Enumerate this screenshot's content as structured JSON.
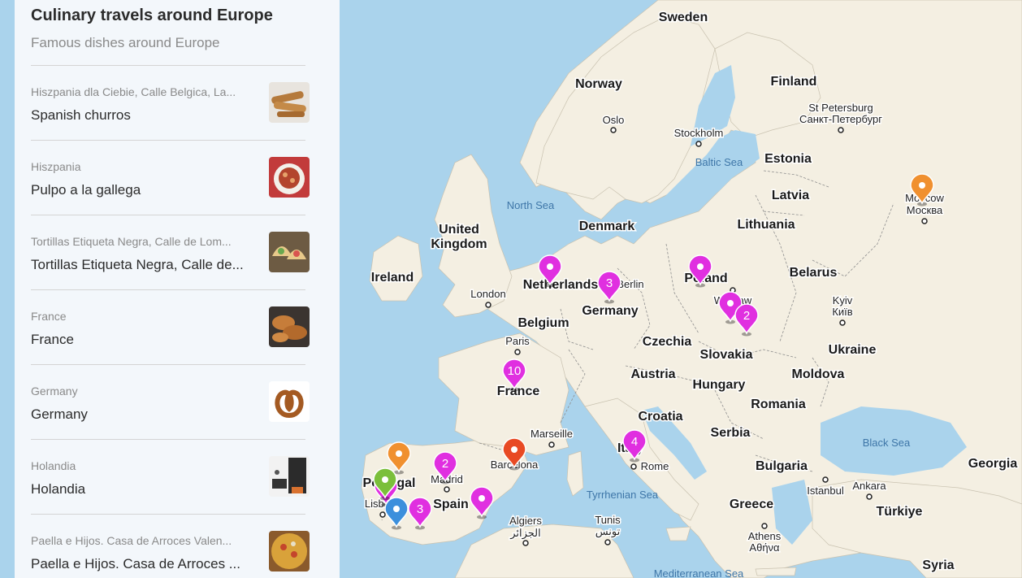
{
  "panel": {
    "title": "Culinary travels around Europe",
    "subtitle": "Famous dishes around Europe",
    "items": [
      {
        "subtitle": "Hiszpania dla Ciebie, Calle Belgica, La...",
        "title": "Spanish churros",
        "thumb": "churros-photo"
      },
      {
        "subtitle": "Hiszpania",
        "title": "Pulpo a la gallega",
        "thumb": "pulpo-photo"
      },
      {
        "subtitle": "Tortillas Etiqueta Negra, Calle de Lom...",
        "title": "Tortillas Etiqueta Negra, Calle de...",
        "thumb": "tacos-photo"
      },
      {
        "subtitle": "France",
        "title": "France",
        "thumb": "croissant-photo"
      },
      {
        "subtitle": "Germany",
        "title": "Germany",
        "thumb": "pretzel-photo"
      },
      {
        "subtitle": "Holandia",
        "title": "Holandia",
        "thumb": "waffle-photo"
      },
      {
        "subtitle": "Paella e Hijos. Casa de Arroces Valen...",
        "title": "Paella e Hijos. Casa de Arroces ...",
        "thumb": "paella-photo"
      }
    ]
  },
  "map": {
    "countries": [
      "Sweden",
      "Norway",
      "Finland",
      "Estonia",
      "Latvia",
      "Lithuania",
      "Denmark",
      "United",
      "Kingdom",
      "Ireland",
      "Netherlands",
      "Belgium",
      "Germany",
      "Poland",
      "Belarus",
      "Czechia",
      "Slovakia",
      "Austria",
      "Hungary",
      "Ukraine",
      "Moldova",
      "Romania",
      "France",
      "Croatia",
      "Serbia",
      "Bulgaria",
      "Italy",
      "Spain",
      "Portugal",
      "Greece",
      "Türkiye",
      "Syria",
      "Georgia"
    ],
    "cities": [
      "Oslo",
      "Stockholm",
      "St Petersburg",
      "Санкт-Петербург",
      "Moscow",
      "Москва",
      "London",
      "Paris",
      "Berlin",
      "Warsaw",
      "Kyiv",
      "Київ",
      "Marseille",
      "Barcelona",
      "Madrid",
      "Lisbon",
      "Rome",
      "Algiers",
      "الجزائر",
      "Tunis",
      "تونس",
      "Athens",
      "Αθήνα",
      "Istanbul",
      "Ankara"
    ],
    "seas": [
      "Baltic Sea",
      "North Sea",
      "Black Sea",
      "Tyrrhenian Sea",
      "Mediterranean Sea"
    ],
    "pins": [
      {
        "count": "",
        "color": "#e02fe0"
      },
      {
        "count": "3",
        "color": "#e02fe0"
      },
      {
        "count": "",
        "color": "#e02fe0"
      },
      {
        "count": "",
        "color": "#e02fe0"
      },
      {
        "count": "2",
        "color": "#e02fe0"
      },
      {
        "count": "10",
        "color": "#e02fe0"
      },
      {
        "count": "4",
        "color": "#e02fe0"
      },
      {
        "count": "",
        "color": "#e84a24"
      },
      {
        "count": "2",
        "color": "#e02fe0"
      },
      {
        "count": "",
        "color": "#f0902f"
      },
      {
        "count": "",
        "color": "#e02fe0"
      },
      {
        "count": "",
        "color": "#e02fe0"
      },
      {
        "count": "",
        "color": "#7bbf3a"
      },
      {
        "count": "",
        "color": "#3c8fdc"
      },
      {
        "count": "3",
        "color": "#e02fe0"
      },
      {
        "count": "",
        "color": "#f0902f"
      }
    ]
  },
  "colors": {
    "land": "#f4efe2",
    "water": "#aad3ec",
    "pin_magenta": "#e02fe0",
    "pin_orange": "#f0902f",
    "pin_red": "#e84a24",
    "pin_green": "#7bbf3a",
    "pin_blue": "#3c8fdc"
  }
}
